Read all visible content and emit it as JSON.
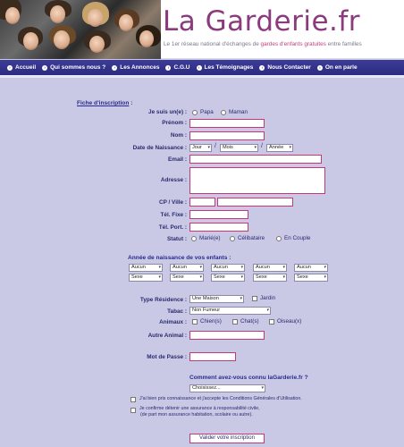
{
  "header": {
    "logo": "La Garderie.fr",
    "tagline_pre": "Le 1er réseau national d'échanges de ",
    "tagline_hl": "gardes d'enfants gratuites",
    "tagline_post": " entre familles"
  },
  "menu": [
    {
      "label": "Accueil"
    },
    {
      "label": "Qui sommes nous ?"
    },
    {
      "label": "Les Annonces"
    },
    {
      "label": "C.G.U"
    },
    {
      "label": "Les Témoignages"
    },
    {
      "label": "Nous Contacter"
    },
    {
      "label": "On en parle"
    }
  ],
  "form": {
    "section_title": "Fiche d'inscription",
    "section_colon": " :",
    "je_suis_label": "Je suis un(e) :",
    "papa": "Papa",
    "maman": "Maman",
    "prenom_label": "Prénom :",
    "nom_label": "Nom :",
    "dob_label": "Date de Naissance :",
    "dob_jour": "Jour",
    "dob_mois": "Mois",
    "dob_annee": "Année",
    "dob_sep": "/",
    "email_label": "Email :",
    "adresse_label": "Adresse :",
    "cp_label": "CP / Ville :",
    "tel_fixe_label": "Tél. Fixe :",
    "tel_port_label": "Tél. Port. :",
    "statut_label": "Statut :",
    "statut_options": [
      "Marié(e)",
      "Célibataire",
      "En Couple"
    ],
    "enfants_title": "Année de naissance de vos enfants :",
    "enfants": [
      {
        "annee": "Aucun",
        "sexe": "Sexe"
      },
      {
        "annee": "Aucun",
        "sexe": "Sexe"
      },
      {
        "annee": "Aucun",
        "sexe": "Sexe"
      },
      {
        "annee": "Aucun",
        "sexe": "Sexe"
      },
      {
        "annee": "Aucun",
        "sexe": "Sexe"
      }
    ],
    "type_res_label": "Type Résidence :",
    "type_res_value": "Une Maison",
    "jardin": "Jardin",
    "tabac_label": "Tabac :",
    "tabac_value": "Non Fumeur",
    "animaux_label": "Animaux :",
    "animaux_options": [
      "Chien(s)",
      "Chat(s)",
      "Oiseau(x)"
    ],
    "autre_animal_label": "Autre Animal :",
    "mdp_label": "Mot de Passe :",
    "connu_title": "Comment avez-vous connu laGarderie.fr ?",
    "connu_value": "Choisissez...",
    "cgu_text": "J'ai bien pris connaissance et j'accepte les Conditions Générales d'Utilisation.",
    "assur_line1": "Je confirme détenir une assurance à responsabilité civile,",
    "assur_line2": "(de part mon assurance habitation, scolaire ou autre).",
    "submit": "Valider votre inscription"
  }
}
